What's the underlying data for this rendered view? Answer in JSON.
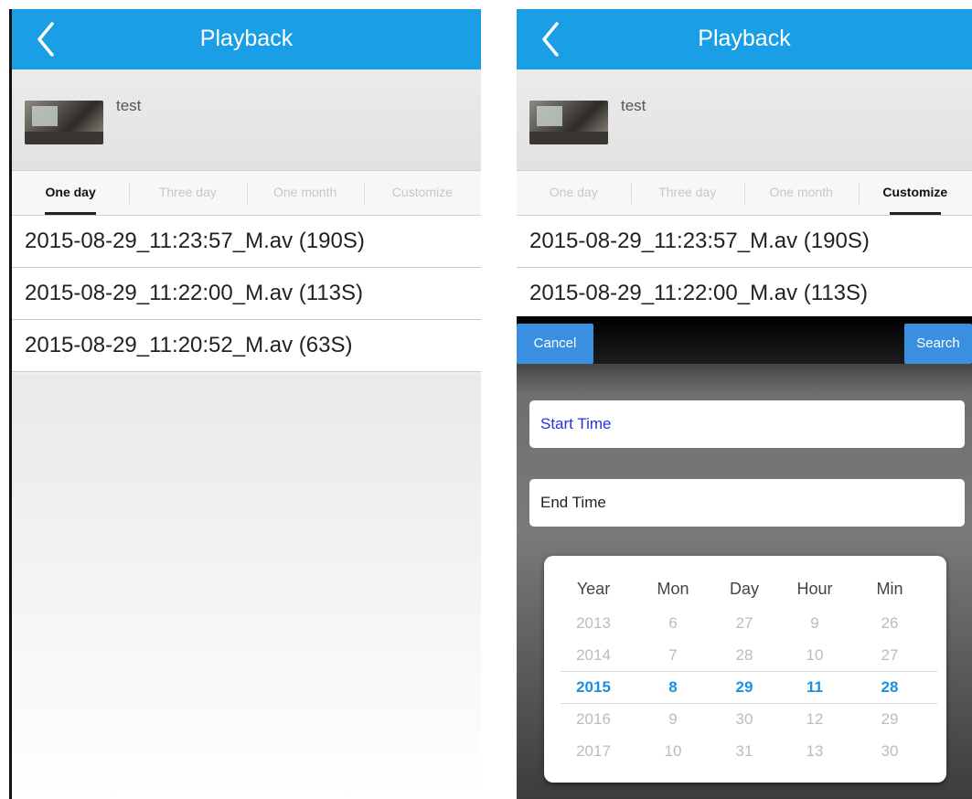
{
  "left": {
    "title": "Playback",
    "device_name": "test",
    "tabs": [
      "One day",
      "Three day",
      "One month",
      "Customize"
    ],
    "active_tab": 0,
    "files": [
      "2015-08-29_11:23:57_M.av (190S)",
      "2015-08-29_11:22:00_M.av (113S)",
      "2015-08-29_11:20:52_M.av (63S)"
    ]
  },
  "right": {
    "title": "Playback",
    "device_name": "test",
    "tabs": [
      "One day",
      "Three day",
      "One month",
      "Customize"
    ],
    "active_tab": 3,
    "files": [
      "2015-08-29_11:23:57_M.av (190S)",
      "2015-08-29_11:22:00_M.av (113S)"
    ],
    "dialog": {
      "cancel_label": "Cancel",
      "search_label": "Search",
      "start_time_label": "Start Time",
      "end_time_label": "End Time",
      "picker": {
        "columns": [
          {
            "header": "Year",
            "values": [
              "2013",
              "2014",
              "2015",
              "2016",
              "2017"
            ]
          },
          {
            "header": "Mon",
            "values": [
              "6",
              "7",
              "8",
              "9",
              "10"
            ]
          },
          {
            "header": "Day",
            "values": [
              "27",
              "28",
              "29",
              "30",
              "31"
            ]
          },
          {
            "header": "Hour",
            "values": [
              "9",
              "10",
              "11",
              "12",
              "13"
            ]
          },
          {
            "header": "Min",
            "values": [
              "26",
              "27",
              "28",
              "29",
              "30"
            ]
          }
        ],
        "selected_index": 2
      }
    }
  },
  "icons": {
    "back": "back-arrow-icon"
  },
  "colors": {
    "appbar": "#1a9ee6",
    "button": "#3a8fe0",
    "selected": "#1d8fe0",
    "start_time_text": "#2b2fe0"
  }
}
